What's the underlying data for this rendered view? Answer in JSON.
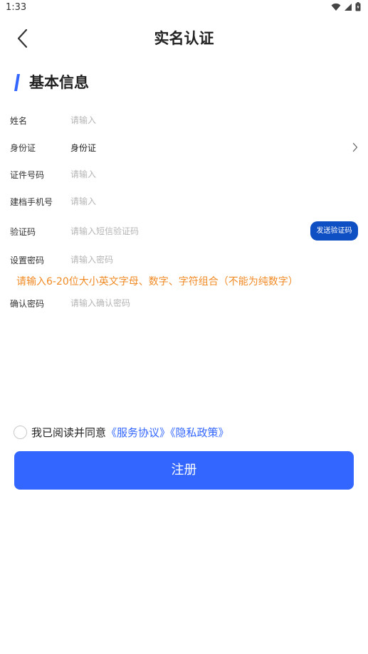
{
  "status_bar": {
    "time": "1:33"
  },
  "nav": {
    "title": "实名认证"
  },
  "section": {
    "title": "基本信息"
  },
  "colors": {
    "accent": "#3366ff",
    "button_dark": "#0f4fc4",
    "hint": "#f08a24"
  },
  "form": {
    "name": {
      "label": "姓名",
      "placeholder": "请输入"
    },
    "id_type": {
      "label": "身份证",
      "value": "身份证"
    },
    "id_number": {
      "label": "证件号码",
      "placeholder": "请输入"
    },
    "phone": {
      "label": "建档手机号",
      "placeholder": "请输入"
    },
    "code": {
      "label": "验证码",
      "placeholder": "请输入短信验证码",
      "button": "发送验证码"
    },
    "password": {
      "label": "设置密码",
      "placeholder": "请输入密码"
    },
    "password_hint": "请输入6-20位大小英文字母、数字、字符组合（不能为纯数字）",
    "confirm": {
      "label": "确认密码",
      "placeholder": "请输入确认密码"
    }
  },
  "agreement": {
    "text": "我已阅读并同意",
    "service_link": "《服务协议》",
    "privacy_link": "《隐私政策》",
    "checked": false
  },
  "register_button": "注册"
}
